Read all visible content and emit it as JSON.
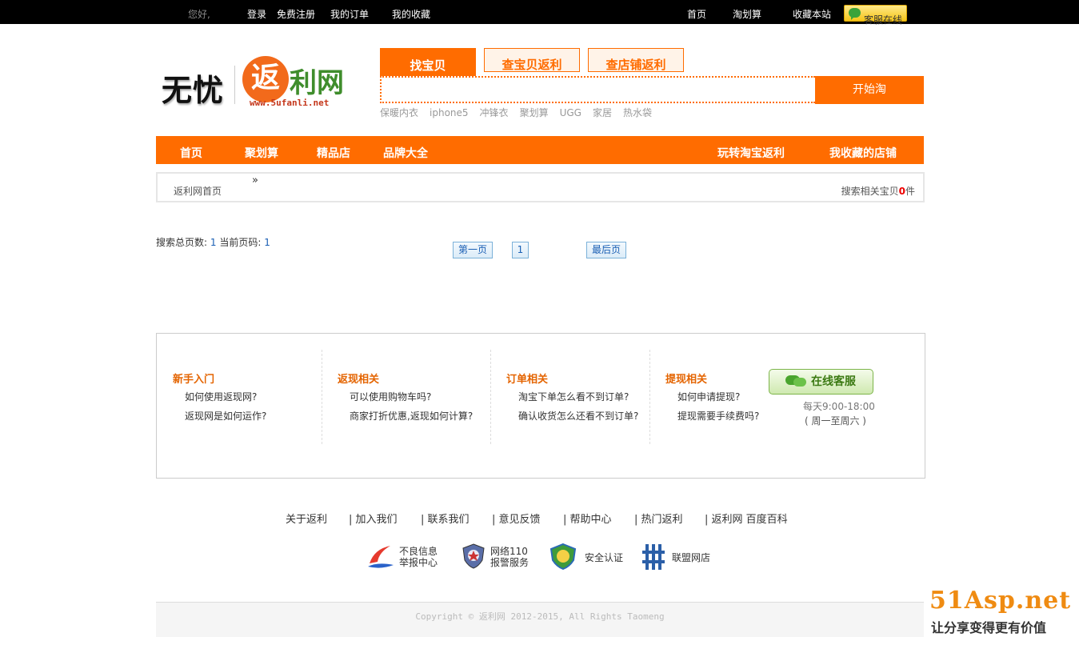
{
  "topbar": {
    "greeting": "您好,",
    "login": "登录",
    "register": "免费注册",
    "orders": "我的订单",
    "favorites": "我的收藏",
    "home": "首页",
    "juhuasuan": "淘划算",
    "bookmark": "收藏本站",
    "service": "客服在线"
  },
  "logo": {
    "left_text": "无忧",
    "circle_char": "返",
    "right_text": "利网",
    "url": "www.5ufanli.net"
  },
  "search": {
    "tabs": [
      "找宝贝",
      "查宝贝返利",
      "查店铺返利"
    ],
    "input_value": "",
    "button": "开始淘",
    "hotwords": [
      "保暖内衣",
      "iphone5",
      "冲锋衣",
      "聚划算",
      "UGG",
      "家居",
      "热水袋"
    ]
  },
  "nav": {
    "left": [
      "首页",
      "聚划算",
      "精品店",
      "品牌大全"
    ],
    "right": [
      "玩转淘宝返利",
      "我收藏的店铺"
    ]
  },
  "breadcrumb": {
    "home": "返利网首页",
    "arrow": "»",
    "count_prefix": "搜索相关宝贝",
    "count": "0",
    "count_suffix": "件"
  },
  "pagination": {
    "total_label": "搜索总页数:",
    "total": "1",
    "current_label": "当前页码:",
    "current": "1",
    "first": "第一页",
    "page": "1",
    "last": "最后页"
  },
  "help": {
    "columns": [
      {
        "title": "新手入门",
        "items": [
          "如何使用返现网?",
          "返现网是如何运作?"
        ]
      },
      {
        "title": "返现相关",
        "items": [
          "可以使用购物车吗?",
          "商家打折优惠,返现如何计算?"
        ]
      },
      {
        "title": "订单相关",
        "items": [
          "淘宝下单怎么看不到订单?",
          "确认收货怎么还看不到订单?"
        ]
      },
      {
        "title": "提现相关",
        "items": [
          "如何申请提现?",
          "提现需要手续费吗?"
        ]
      }
    ],
    "online_service": "在线客服",
    "hours": "每天9:00-18:00",
    "days": "( 周一至周六 )"
  },
  "footer": {
    "links": [
      "关于返利",
      "| 加入我们",
      "| 联系我们",
      "| 意见反馈",
      "| 帮助中心",
      "| 热门返利",
      "| 返利网 百度百科"
    ],
    "badges": [
      {
        "line1": "不良信息",
        "line2": "举报中心"
      },
      {
        "line1": "网络110",
        "line2": "报警服务"
      },
      {
        "line1": "安全认证",
        "line2": ""
      },
      {
        "line1": "联盟网店",
        "line2": ""
      }
    ],
    "copyright": "Copyright © 返利网 2012-2015, All Rights Taomeng"
  },
  "watermark": {
    "brand": "51Asp.net",
    "slogan": "让分享变得更有价值"
  },
  "colors": {
    "accent": "#ff6c00",
    "topbar": "#000000",
    "help_title": "#e46400",
    "link_blue": "#1a5fb4"
  }
}
